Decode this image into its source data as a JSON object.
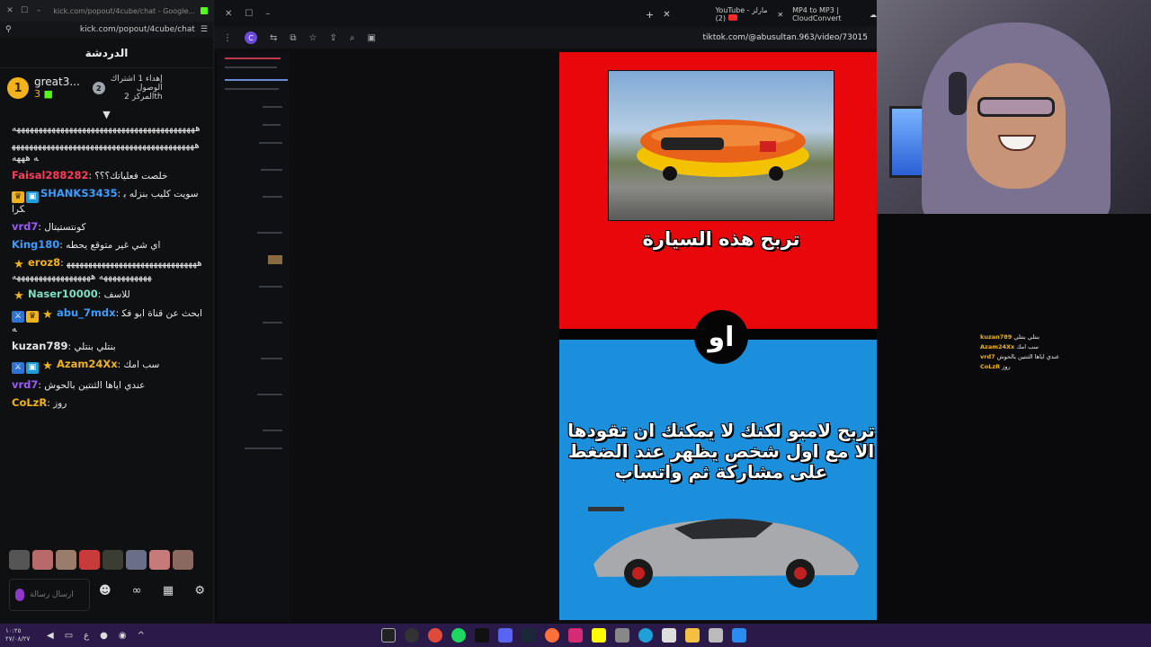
{
  "chat_window": {
    "tab_title": "kick.com/popout/4cube/chat - Google...",
    "url": "kick.com/popout/4cube/chat",
    "header": "الدردشة",
    "pinned": {
      "rank": "1",
      "username": "great3...",
      "count": "3",
      "rank2": "2",
      "gift_text_line1": "إهداء 1 اشتراك",
      "gift_text_line2": "الوصول",
      "gift_text_line3": "2 المركزth"
    },
    "messages": [
      {
        "user": "",
        "text": "ههههههههههههههههههههههههههههههههههههههههههه",
        "user_color": "#e6e6e6"
      },
      {
        "user": "",
        "text": "هههههههههههههههههههههههههههههههههههههههههههه هههه",
        "user_color": "#e6e6e6"
      },
      {
        "user": "Faisal288282",
        "text": "خلصت فعلياتك؟؟؟",
        "user_color": "#ff3b5c"
      },
      {
        "user": "SHANKS3435",
        "text": "سويت كليب بنزله بكرا",
        "user_color": "#3c9dff"
      },
      {
        "user": "vrd7",
        "text": "كونتستيتال",
        "user_color": "#9b59ff"
      },
      {
        "user": "King180",
        "text": "اي شي غير متوقع يحطه",
        "user_color": "#3c9dff"
      },
      {
        "user": "eroz8",
        "text": "ههههههههههههههههههههههههههههههههههههههههههه ههههههههههههههههههه",
        "user_color": "#f2b21b"
      },
      {
        "user": "Naser10000",
        "text": "للاسف",
        "user_color": "#7be0c0"
      },
      {
        "user": "abu_7mdx",
        "text": "ابحث عن قناة ابو فكه",
        "user_color": "#3c9dff"
      },
      {
        "user": "kuzan789",
        "text": "بنتلي بنتلي",
        "user_color": "#e6e6e6"
      },
      {
        "user": "Azam24Xx",
        "text": "سب امك",
        "user_color": "#f2b21b"
      },
      {
        "user": "vrd7",
        "text": "عندي اياها الثنتين بالحوش",
        "user_color": "#9b59ff"
      },
      {
        "user": "CoLzR",
        "text": "روز",
        "user_color": "#f2b21b"
      }
    ],
    "input_placeholder": "ارسال رسالة"
  },
  "browser": {
    "tabs": [
      {
        "label": "YouTube - مارلز (2)"
      },
      {
        "label": "MP4 to MP3 | CloudConvert"
      }
    ],
    "url": "tiktok.com/@abusultan.963/video/73015"
  },
  "video": {
    "option1_text": "تربح هذه السيارة",
    "or_text": "او",
    "option2_text": "تربح لامبو لكنك لا يمكنك ان تقودها الا مع اول شخص يظهر عند الضغط على مشاركة ثم واتساب",
    "colors": {
      "top": "#e8080c",
      "bottom": "#1b8fdc",
      "divider": "#050505"
    }
  },
  "overlay_chat": [
    {
      "user": "kuzan789",
      "text": "بنتلي بنتلي"
    },
    {
      "user": "Azam24Xx",
      "text": "سب امك"
    },
    {
      "user": "vrd7",
      "text": "عندي اياها الثنتين بالحوش"
    },
    {
      "user": "CoLzR",
      "text": "روز"
    }
  ],
  "taskbar": {
    "time": "١٠:٢٥",
    "date": "٢٧/٠٨/٢٧",
    "lang": "ع"
  }
}
